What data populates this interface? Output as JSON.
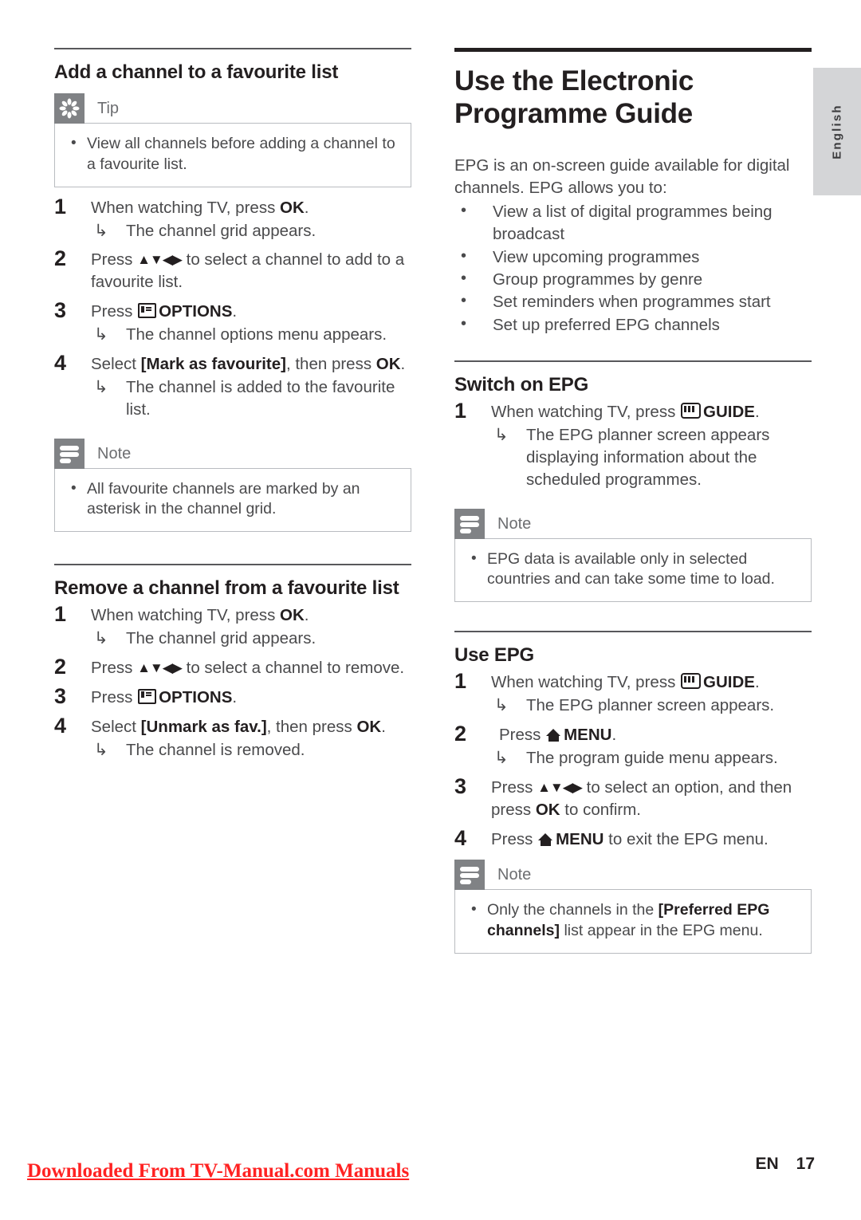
{
  "page": {
    "language_tab": "English",
    "footer": {
      "watermark": "Downloaded From TV-Manual.com Manuals",
      "locale_code": "EN",
      "page_number": "17"
    }
  },
  "left_column": {
    "section_favourite_add": {
      "heading": "Add a channel to a favourite list",
      "tip": {
        "title": "Tip",
        "icon": "tip-asterisk-icon",
        "items": [
          "View all channels before adding a channel to a favourite list."
        ]
      },
      "steps": [
        {
          "num": "1",
          "text_before": "When watching TV, press ",
          "bold": "OK",
          "text_after": ".",
          "result": "The channel grid appears."
        },
        {
          "num": "2",
          "text_before": "Press ",
          "navpad": "▲▼◀▶",
          "text_after": " to select a channel to add to a favourite list."
        },
        {
          "num": "3",
          "text_before": "Press ",
          "icon": "options-icon",
          "bold": "OPTIONS",
          "text_after": ".",
          "result": "The channel options menu appears."
        },
        {
          "num": "4",
          "text_before": "Select ",
          "bold": "[Mark as favourite]",
          "text_mid": ", then press ",
          "bold2": "OK",
          "text_after": ".",
          "result": "The channel is added to the favourite list."
        }
      ],
      "note": {
        "title": "Note",
        "icon": "note-lines-icon",
        "items": [
          "All favourite channels are marked by an asterisk in the channel grid."
        ]
      }
    },
    "section_favourite_remove": {
      "heading": "Remove a channel from a favourite list",
      "steps": [
        {
          "num": "1",
          "text_before": "When watching TV, press ",
          "bold": "OK",
          "text_after": ".",
          "result": "The channel grid appears."
        },
        {
          "num": "2",
          "text_before": "Press ",
          "navpad": "▲▼◀▶",
          "text_after": " to select a channel to remove."
        },
        {
          "num": "3",
          "text_before": "Press ",
          "icon": "options-icon",
          "bold": "OPTIONS",
          "text_after": "."
        },
        {
          "num": "4",
          "text_before": "Select ",
          "bold": "[Unmark as fav.]",
          "text_mid": ", then press ",
          "bold2": "OK",
          "text_after": ".",
          "result": "The channel is removed."
        }
      ]
    }
  },
  "right_column": {
    "chapter": {
      "heading": "Use the Electronic Programme Guide",
      "intro": "EPG is an on-screen guide available for digital channels. EPG allows you to:",
      "bullets": [
        "View a list of digital programmes being broadcast",
        "View upcoming programmes",
        "Group programmes by genre",
        "Set reminders when programmes start",
        "Set up preferred EPG channels"
      ]
    },
    "section_switch_on_epg": {
      "heading": "Switch on EPG",
      "steps": [
        {
          "num": "1",
          "text_before": "When watching TV, press ",
          "icon": "guide-icon",
          "bold": "GUIDE",
          "text_after": ".",
          "result": "The EPG planner screen appears displaying information about the scheduled programmes."
        }
      ],
      "note": {
        "title": "Note",
        "icon": "note-lines-icon",
        "items": [
          "EPG data is available only in selected countries and can take some time to load."
        ]
      }
    },
    "section_use_epg": {
      "heading": "Use EPG",
      "steps": [
        {
          "num": "1",
          "text_before": "When watching TV, press ",
          "icon": "guide-icon",
          "bold": "GUIDE",
          "text_after": ".",
          "result": "The EPG planner screen appears."
        },
        {
          "num": "2",
          "text_before": "Press ",
          "icon": "home-icon",
          "bold": "MENU",
          "text_after": ".",
          "result": "The program guide menu appears."
        },
        {
          "num": "3",
          "text_before": "Press ",
          "navpad": "▲▼◀▶",
          "text_mid": " to select an option, and then press ",
          "bold2": "OK",
          "text_after": " to confirm."
        },
        {
          "num": "4",
          "text_before": "Press ",
          "icon": "home-icon",
          "bold": "MENU",
          "text_after": " to exit the EPG menu."
        }
      ],
      "note": {
        "title": "Note",
        "icon": "note-lines-icon",
        "items_rich": [
          {
            "before": "Only the channels in the ",
            "bold": "[Preferred EPG channels]",
            "after": " list appear in the EPG menu."
          }
        ]
      }
    }
  }
}
